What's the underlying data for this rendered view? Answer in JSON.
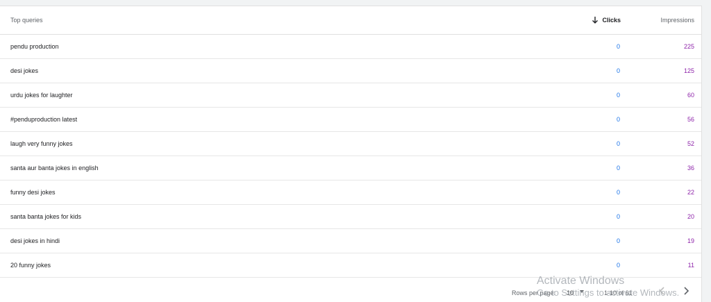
{
  "header": {
    "query_label": "Top queries",
    "clicks_label": "Clicks",
    "impressions_label": "Impressions"
  },
  "rows": [
    {
      "query": "pendu production",
      "clicks": "0",
      "impressions": "225"
    },
    {
      "query": "desi jokes",
      "clicks": "0",
      "impressions": "125"
    },
    {
      "query": "urdu jokes for laughter",
      "clicks": "0",
      "impressions": "60"
    },
    {
      "query": "#penduproduction latest",
      "clicks": "0",
      "impressions": "56"
    },
    {
      "query": "laugh very funny jokes",
      "clicks": "0",
      "impressions": "52"
    },
    {
      "query": "santa aur banta jokes in english",
      "clicks": "0",
      "impressions": "36"
    },
    {
      "query": "funny desi jokes",
      "clicks": "0",
      "impressions": "22"
    },
    {
      "query": "santa banta jokes for kids",
      "clicks": "0",
      "impressions": "20"
    },
    {
      "query": "desi jokes in hindi",
      "clicks": "0",
      "impressions": "19"
    },
    {
      "query": "20 funny jokes",
      "clicks": "0",
      "impressions": "11"
    }
  ],
  "footer": {
    "rows_per_page_label": "Rows per page:",
    "rows_per_page_value": "10",
    "range": "1-10 of 61"
  },
  "watermark": {
    "line1": "Activate Windows",
    "line2": "Go to Settings to activate Windows."
  },
  "colors": {
    "clicks": "#1a73e8",
    "impressions": "#8e24aa"
  },
  "icons": {
    "sort": "arrow-down-icon",
    "prev": "chevron-left-icon",
    "next": "chevron-right-icon"
  }
}
